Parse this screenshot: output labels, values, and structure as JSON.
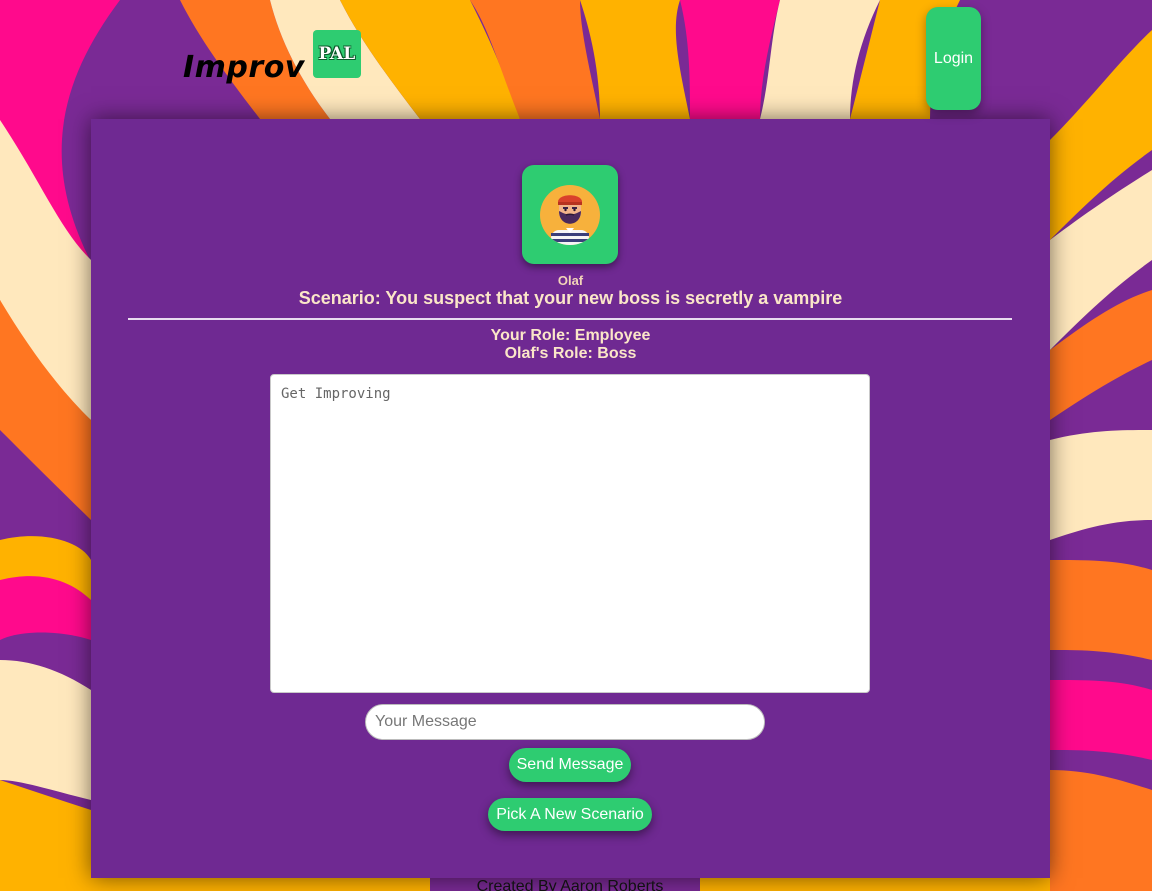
{
  "header": {
    "logo_text": "Improv",
    "logo_badge": "PAL",
    "login_label": "Login"
  },
  "character": {
    "name": "Olaf",
    "avatar_icon": "bearded-man-avatar-icon"
  },
  "scenario": {
    "text": "Scenario: You suspect that your new boss is secretly a vampire",
    "your_role": "Your Role: Employee",
    "partner_role": "Olaf's Role: Boss"
  },
  "chat": {
    "placeholder": "Get Improving",
    "message_placeholder": "Your Message"
  },
  "actions": {
    "send_label": "Send Message",
    "pick_label": "Pick A New Scenario"
  },
  "footer": {
    "credit": "Created By Aaron Roberts"
  },
  "colors": {
    "accent_green": "#2ecc71",
    "panel_purple": "#6f2992",
    "bg_pink": "#ff0a8c",
    "bg_orange": "#ff7621",
    "bg_yellow": "#ffb200",
    "bg_cream": "#ffe8bd"
  }
}
